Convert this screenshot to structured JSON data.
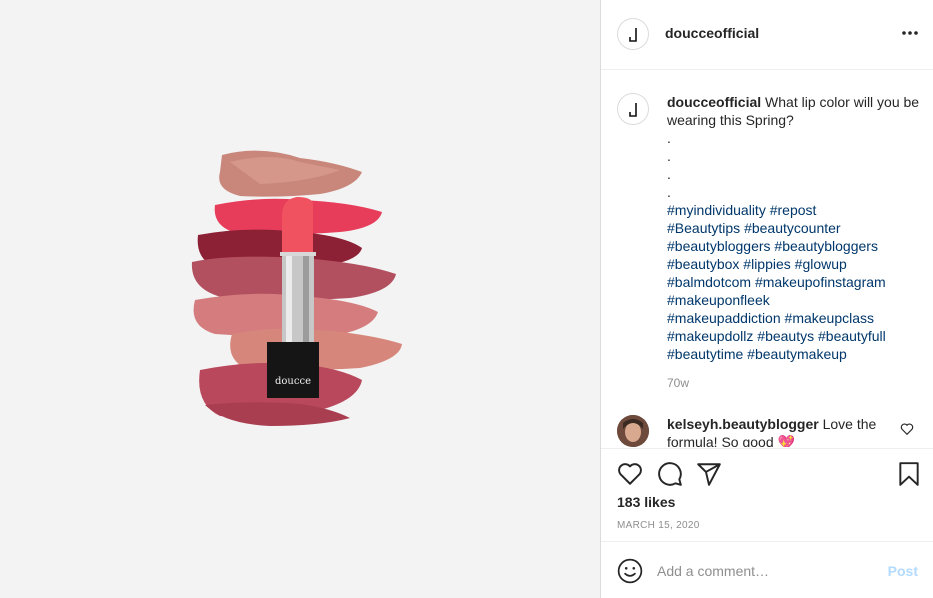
{
  "post": {
    "username": "doucceofficial",
    "caption_user": "doucceofficial",
    "caption_text": "What lip color will you be wearing this Spring?",
    "caption_dots": [
      ".",
      ".",
      ".",
      "."
    ],
    "hashtag_lines": [
      [
        "#myindividuality",
        "#repost"
      ],
      [
        "#Beautytips",
        "#beautycounter"
      ],
      [
        "#beautybloggers",
        "#beautybloggers"
      ],
      [
        "#beautybox",
        "#lippies",
        "#glowup"
      ],
      [
        "#balmdotcom",
        "#makeupofinstagram"
      ],
      [
        "#makeuponfleek"
      ],
      [
        "#makeupaddiction",
        "#makeupclass"
      ],
      [
        "#makeupdollz",
        "#beautys",
        "#beautyfull"
      ],
      [
        "#beautytime",
        "#beautymakeup"
      ]
    ],
    "age": "70w",
    "likes": "183 likes",
    "date": "MARCH 15, 2020"
  },
  "comment": {
    "username": "kelseyh.beautyblogger",
    "text": "Love the formula! So good 💖"
  },
  "add_comment": {
    "placeholder": "Add a comment…",
    "post_label": "Post"
  },
  "image": {
    "brand_text": "doucce"
  },
  "icons": {
    "more": "more-options-icon",
    "heart": "heart-icon",
    "comment": "comment-icon",
    "share": "share-icon",
    "save": "bookmark-icon",
    "emoji": "emoji-icon"
  },
  "colors": {
    "hashtag": "#00376b",
    "post_button_disabled": "#b3dbff",
    "muted": "#8e8e8e"
  }
}
